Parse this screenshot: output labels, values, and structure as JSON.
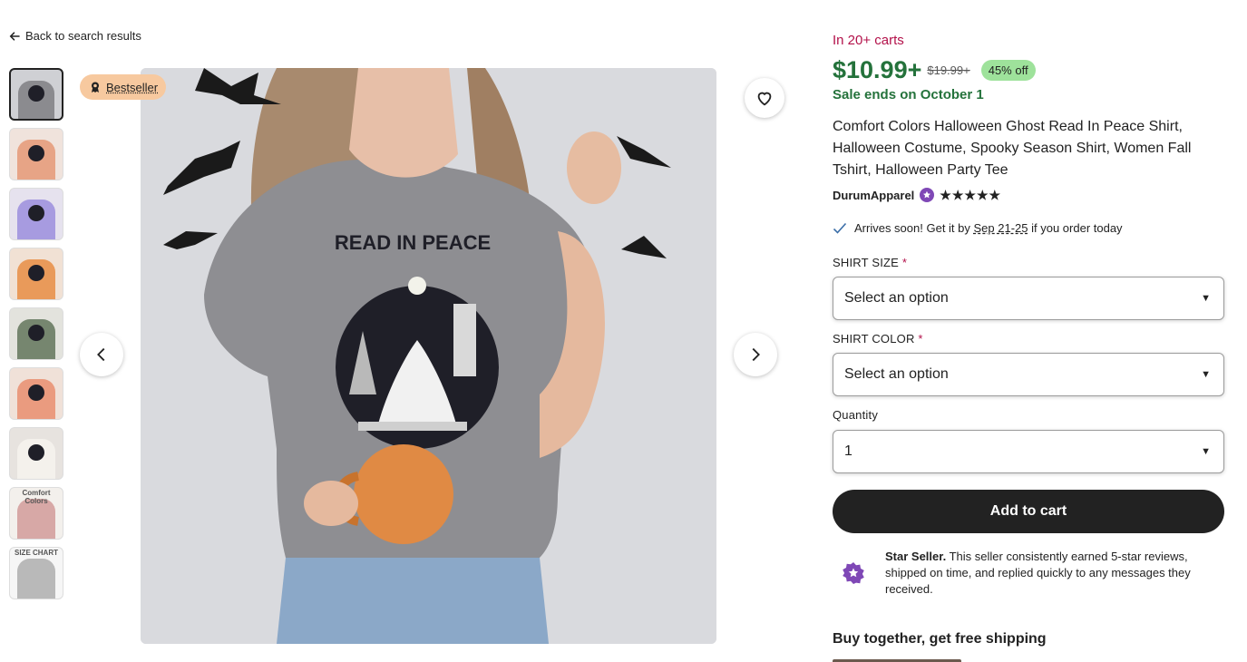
{
  "nav": {
    "back_label": "Back to search results"
  },
  "gallery": {
    "badge": "Bestseller",
    "thumbnails": [
      {
        "shirt_color": "#8b8b8f",
        "bg": "#cfd0d4"
      },
      {
        "shirt_color": "#e7a486",
        "bg": "#f0e3dc"
      },
      {
        "shirt_color": "#a79be0",
        "bg": "#e6e2ee"
      },
      {
        "shirt_color": "#e99a5a",
        "bg": "#f1e1d4"
      },
      {
        "shirt_color": "#76866f",
        "bg": "#e3e3dd"
      },
      {
        "shirt_color": "#ea9b7f",
        "bg": "#f0e1d8"
      },
      {
        "shirt_color": "#f4f1ec",
        "bg": "#e7e3df"
      },
      {
        "shirt_color": "#d7a8a6",
        "bg": "#f3f0ec"
      },
      {
        "shirt_color": "#b9b9b9",
        "bg": "#f6f6f6"
      }
    ],
    "thumb_8_text": "Comfort Colors",
    "thumb_9_text": "SIZE CHART",
    "shirt_print_text": "READ IN PEACE"
  },
  "listing": {
    "carts_text": "In 20+ carts",
    "price": "$10.99+",
    "original_price": "$19.99+",
    "discount_badge": "45% off",
    "sale_ends": "Sale ends on October 1",
    "title": "Comfort Colors Halloween Ghost Read In Peace Shirt, Halloween Costume, Spooky Season Shirt, Women Fall Tshirt, Halloween Party Tee",
    "shop_name": "DurumApparel",
    "rating_stars": 5,
    "arrives_prefix": "Arrives soon! Get it by ",
    "arrives_dates": "Sep 21-25",
    "arrives_suffix": " if you order today"
  },
  "options": {
    "size_label": "SHIRT SIZE",
    "size_value": "Select an option",
    "color_label": "SHIRT COLOR",
    "color_value": "Select an option",
    "required_mark": "*",
    "quantity_label": "Quantity",
    "quantity_value": "1"
  },
  "actions": {
    "add_to_cart": "Add to cart"
  },
  "star_seller": {
    "title": "Star Seller.",
    "text": " This seller consistently earned 5-star reviews, shipped on time, and replied quickly to any messages they received."
  },
  "buy_together": "Buy together, get free shipping",
  "colors": {
    "price_green": "#24723b",
    "cart_red": "#b3114a",
    "badge_green": "#9ee29b",
    "bestseller_peach": "#f7c99f",
    "star_seller_purple": "#7f48b6"
  }
}
